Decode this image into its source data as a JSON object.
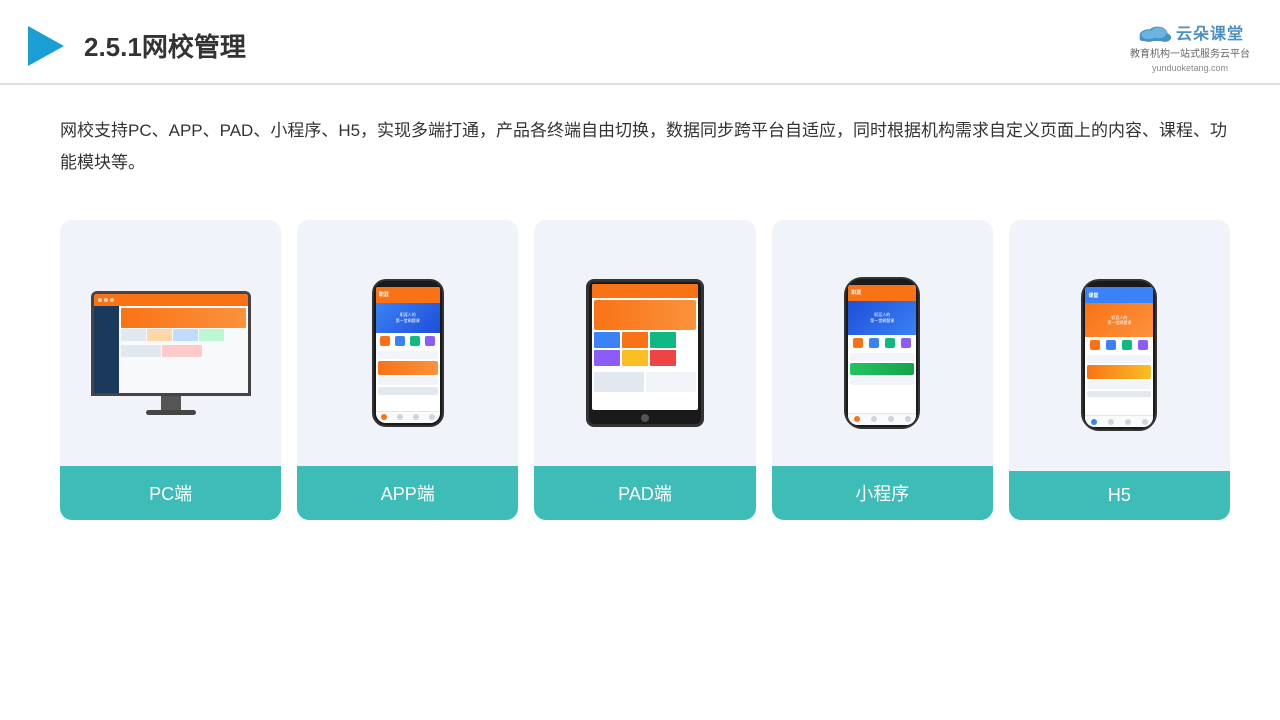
{
  "header": {
    "title": "2.5.1网校管理",
    "brand": {
      "name": "云朵课堂",
      "tagline": "教育机构一站\n式服务云平台",
      "url": "yunduoketang.com"
    }
  },
  "description": {
    "text": "网校支持PC、APP、PAD、小程序、H5，实现多端打通，产品各终端自由切换，数据同步跨平台自适应，同时根据机构需求自定义页面上的内容、课程、功能模块等。"
  },
  "cards": [
    {
      "id": "pc",
      "label": "PC端"
    },
    {
      "id": "app",
      "label": "APP端"
    },
    {
      "id": "pad",
      "label": "PAD端"
    },
    {
      "id": "miniapp",
      "label": "小程序"
    },
    {
      "id": "h5",
      "label": "H5"
    }
  ]
}
